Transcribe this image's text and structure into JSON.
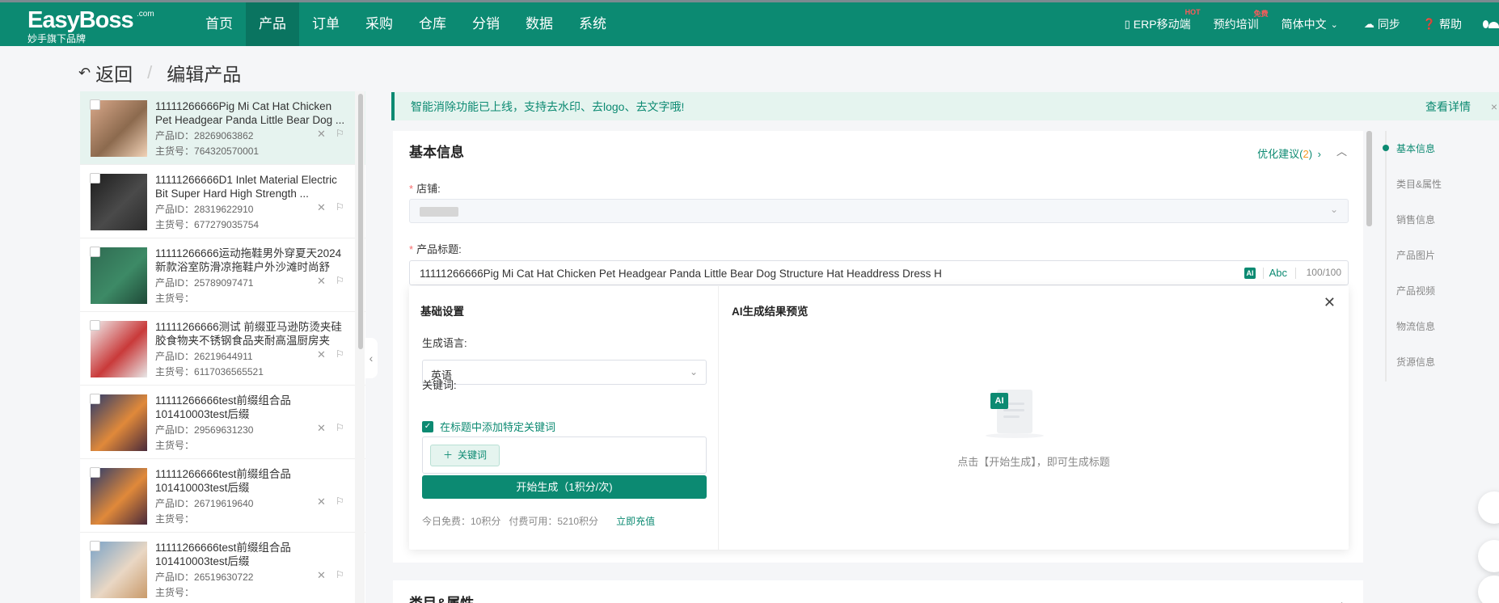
{
  "header": {
    "brand": "EasyBoss",
    "brand_suffix": ".com",
    "brand_sub": "妙手旗下品牌",
    "nav": [
      "首页",
      "产品",
      "订单",
      "采购",
      "仓库",
      "分销",
      "数据",
      "系统"
    ],
    "active_nav": "产品",
    "right": {
      "erp_mobile": "ERP移动端",
      "erp_badge": "HOT",
      "training": "预约培训",
      "training_badge": "免费",
      "language": "简体中文",
      "sync": "同步",
      "help": "帮助"
    }
  },
  "page": {
    "back": "返回",
    "title": "编辑产品"
  },
  "product_list": [
    {
      "title": "11111266666Pig Mi Cat Hat Chicken Pet Headgear Panda Little Bear Dog ...",
      "pid_label": "产品ID：",
      "pid": "28269063862",
      "sku_label": "主货号：",
      "sku": "764320570001",
      "colors": [
        "#d9a88a",
        "#8c6a4e",
        "#f2d3b8"
      ]
    },
    {
      "title": "11111266666D1 Inlet Material Electric Bit Super Hard High Strength ...",
      "pid_label": "产品ID：",
      "pid": "28319622910",
      "sku_label": "主货号：",
      "sku": "677279035754",
      "colors": [
        "#1d1d1d",
        "#4a4a4a",
        "#2c2c2c"
      ]
    },
    {
      "title": "11111266666运动拖鞋男外穿夏天2024新款浴室防滑凉拖鞋户外沙滩时尚舒适...",
      "pid_label": "产品ID：",
      "pid": "25789097471",
      "sku_label": "主货号：",
      "sku": "",
      "colors": [
        "#2f6b52",
        "#3d8a66",
        "#1f4a38"
      ]
    },
    {
      "title": "11111266666测试 前缀亚马逊防烫夹硅胶食物夹不锈钢食品夹耐高温厨房夹子...",
      "pid_label": "产品ID：",
      "pid": "26219644911",
      "sku_label": "主货号：",
      "sku": "6117036565521",
      "colors": [
        "#f1f1f1",
        "#c93a3a",
        "#e8e8e8"
      ]
    },
    {
      "title": "11111266666test前缀组合品101410003test后缀",
      "pid_label": "产品ID：",
      "pid": "29569631230",
      "sku_label": "主货号：",
      "sku": "",
      "colors": [
        "#2b3a6b",
        "#e0893a",
        "#4a2a3a"
      ]
    },
    {
      "title": "11111266666test前缀组合品101410003test后缀",
      "pid_label": "产品ID：",
      "pid": "26719619640",
      "sku_label": "主货号：",
      "sku": "",
      "colors": [
        "#2b3a6b",
        "#e0893a",
        "#4a2a3a"
      ]
    },
    {
      "title": "11111266666test前缀组合品101410003test后缀",
      "pid_label": "产品ID：",
      "pid": "26519630722",
      "sku_label": "主货号：",
      "sku": "",
      "colors": [
        "#7aa3c8",
        "#e9d7c4",
        "#c99a6a"
      ]
    }
  ],
  "banner": {
    "text": "智能消除功能已上线，支持去水印、去logo、去文字哦!",
    "link": "查看详情"
  },
  "basic_info": {
    "title": "基本信息",
    "optimize_label": "优化建议(",
    "optimize_count": "2",
    "optimize_tail": ")",
    "shop_label": "店铺:",
    "title_label": "产品标题:",
    "title_value": "11111266666Pig Mi Cat Hat Chicken Pet Headgear Panda Little Bear Dog Structure Hat Headdress Dress H",
    "ai_badge": "AI",
    "abc": "Abc",
    "char_count": "100/100"
  },
  "ai_panel": {
    "settings_title": "基础设置",
    "preview_title": "AI生成结果预览",
    "lang_label": "生成语言:",
    "lang_value": "英语",
    "keyword_label": "关键词:",
    "keyword_check": "在标题中添加特定关键词",
    "keyword_btn": "关键词",
    "generate_btn": "开始生成（1积分/次)",
    "free_today": "今日免费：10积分",
    "paid_available": "付费可用：5210积分",
    "recharge": "立即充值",
    "empty_hint": "点击【开始生成】，即可生成标题",
    "empty_ai": "AI"
  },
  "section2": {
    "title": "类目&属性"
  },
  "anchors": [
    "基本信息",
    "类目&属性",
    "销售信息",
    "产品图片",
    "产品视频",
    "物流信息",
    "货源信息"
  ],
  "colors": {
    "primary": "#0c8a72",
    "accent_orange": "#f59a23",
    "required": "#f56c6c"
  }
}
